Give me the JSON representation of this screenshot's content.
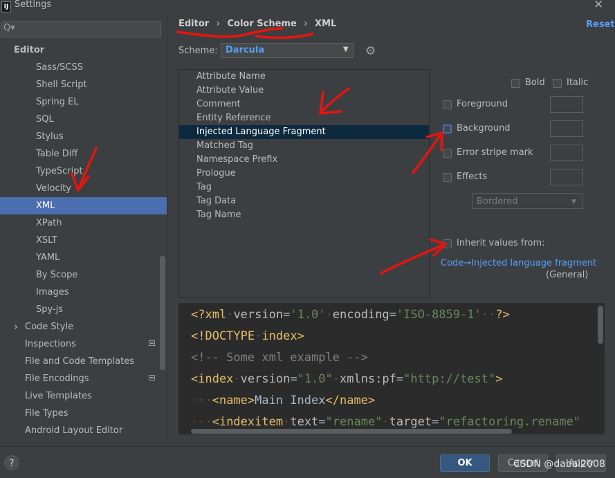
{
  "window": {
    "title": "Settings",
    "logo": "IJ"
  },
  "search": {
    "placeholder": "Q▾"
  },
  "sidebar": {
    "items": [
      {
        "label": "Editor",
        "indent": 0
      },
      {
        "label": "Sass/SCSS"
      },
      {
        "label": "Shell Script"
      },
      {
        "label": "Spring EL"
      },
      {
        "label": "SQL"
      },
      {
        "label": "Stylus"
      },
      {
        "label": "Table Diff"
      },
      {
        "label": "TypeScript"
      },
      {
        "label": "Velocity"
      },
      {
        "label": "XML",
        "selected": true
      },
      {
        "label": "XPath"
      },
      {
        "label": "XSLT"
      },
      {
        "label": "YAML"
      },
      {
        "label": "By Scope"
      },
      {
        "label": "Images"
      },
      {
        "label": "Spy-js"
      },
      {
        "label": "Code Style",
        "expandable": true
      },
      {
        "label": "Inspections",
        "badge": true
      },
      {
        "label": "File and Code Templates"
      },
      {
        "label": "File Encodings",
        "badge": true
      },
      {
        "label": "Live Templates"
      },
      {
        "label": "File Types"
      },
      {
        "label": "Android Layout Editor"
      }
    ]
  },
  "breadcrumb": {
    "editor": "Editor",
    "sep1": "›",
    "color_scheme": "Color Scheme",
    "sep2": "›",
    "xml": "XML"
  },
  "reset_label": "Reset",
  "scheme": {
    "label": "Scheme:",
    "value": "Darcula"
  },
  "attributes": [
    "Attribute Name",
    "Attribute Value",
    "Comment",
    "Entity Reference",
    "Injected Language Fragment",
    "Matched Tag",
    "Namespace Prefix",
    "Prologue",
    "Tag",
    "Tag Data",
    "Tag Name"
  ],
  "selected_attribute": "Injected Language Fragment",
  "options": {
    "bold": "Bold",
    "italic": "Italic",
    "foreground": "Foreground",
    "background": "Background",
    "error_stripe": "Error stripe mark",
    "effects": "Effects",
    "effects_type": "Bordered",
    "inherit": "Inherit values from:",
    "inherit_link": "Code→Injected language fragment",
    "inherit_general": "(General)"
  },
  "preview": {
    "line1": {
      "tag_open": "<?xml",
      "a1": "version",
      "eq1": "=",
      "v1": "'1.0'",
      "a2": "encoding",
      "eq2": "=",
      "v2": "'ISO-8859-1'",
      "end": "?>"
    },
    "line2": {
      "tag": "<!DOCTYPE",
      "rest": "index>"
    },
    "line3": {
      "comment": "<!-- Some xml example -->"
    },
    "line4": {
      "tag": "<index",
      "a1": "version",
      "eq1": "=",
      "v1": "\"1.0\"",
      "ns": "xmlns:pf",
      "eq2": "=",
      "v2": "\"http://test\"",
      "end": ">"
    },
    "line5": {
      "open": "<name>",
      "text": "Main Index",
      "close": "</name>"
    },
    "line6": {
      "tag": "<indexitem",
      "a1": "text",
      "eq1": "=",
      "v1": "\"rename\"",
      "a2": "target",
      "eq2": "=",
      "v2": "\"refactoring.rename\""
    }
  },
  "buttons": {
    "help": "?",
    "ok": "OK",
    "cancel": "Cancel",
    "apply": "Apply"
  },
  "watermark": "CSDN @dabai2008",
  "colors": {
    "selection": "#4b6eaf",
    "accent": "#589df6",
    "annotation": "#e8140f"
  }
}
